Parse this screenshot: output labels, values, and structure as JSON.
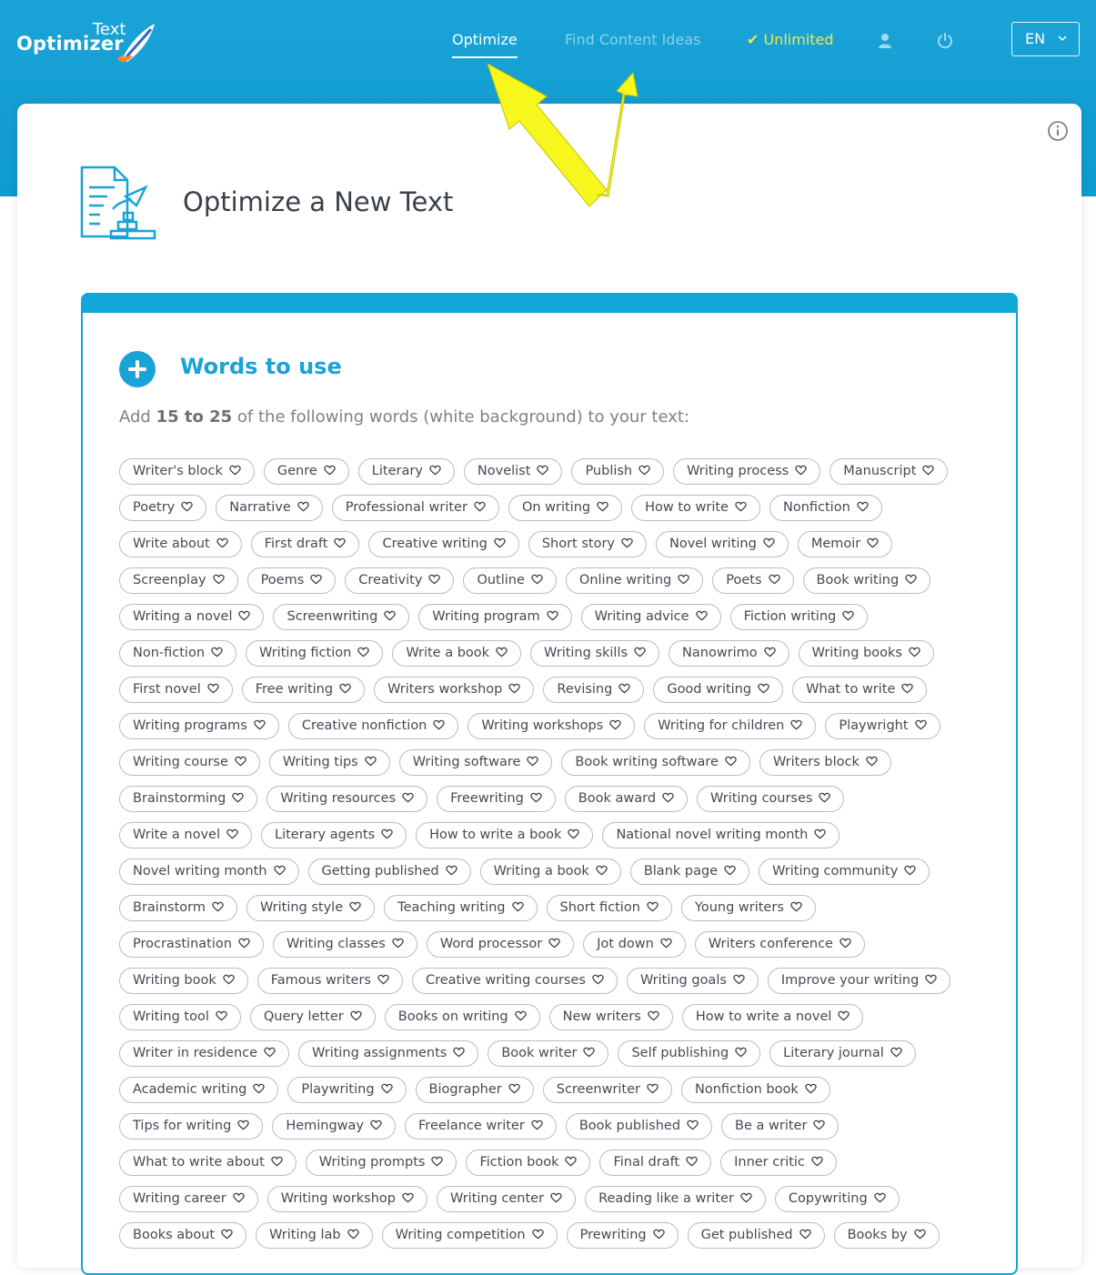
{
  "header": {
    "logo_small": "Text",
    "logo_main": "Optimizer",
    "nav": {
      "optimize": "Optimize",
      "find_content_ideas": "Find Content Ideas",
      "unlimited": "✔ Unlimited"
    },
    "lang": "EN"
  },
  "page": {
    "title": "Optimize a New Text"
  },
  "words_panel": {
    "title": "Words to use",
    "instruction_prefix": "Add ",
    "instruction_range": "15 to 25",
    "instruction_suffix": " of the following words (white background) to your text:",
    "rows": [
      [
        "Writer's block",
        "Genre",
        "Literary",
        "Novelist",
        "Publish",
        "Writing process",
        "Manuscript"
      ],
      [
        "Poetry",
        "Narrative",
        "Professional writer",
        "On writing",
        "How to write",
        "Nonfiction"
      ],
      [
        "Write about",
        "First draft",
        "Creative writing",
        "Short story",
        "Novel writing",
        "Memoir"
      ],
      [
        "Screenplay",
        "Poems",
        "Creativity",
        "Outline",
        "Online writing",
        "Poets",
        "Book writing"
      ],
      [
        "Writing a novel",
        "Screenwriting",
        "Writing program",
        "Writing advice",
        "Fiction writing"
      ],
      [
        "Non-fiction",
        "Writing fiction",
        "Write a book",
        "Writing skills",
        "Nanowrimo",
        "Writing books"
      ],
      [
        "First novel",
        "Free writing",
        "Writers workshop",
        "Revising",
        "Good writing",
        "What to write"
      ],
      [
        "Writing programs",
        "Creative nonfiction",
        "Writing workshops",
        "Writing for children",
        "Playwright"
      ],
      [
        "Writing course",
        "Writing tips",
        "Writing software",
        "Book writing software",
        "Writers block"
      ],
      [
        "Brainstorming",
        "Writing resources",
        "Freewriting",
        "Book award",
        "Writing courses"
      ],
      [
        "Write a novel",
        "Literary agents",
        "How to write a book",
        "National novel writing month"
      ],
      [
        "Novel writing month",
        "Getting published",
        "Writing a book",
        "Blank page",
        "Writing community"
      ],
      [
        "Brainstorm",
        "Writing style",
        "Teaching writing",
        "Short fiction",
        "Young writers"
      ],
      [
        "Procrastination",
        "Writing classes",
        "Word processor",
        "Jot down",
        "Writers conference"
      ],
      [
        "Writing book",
        "Famous writers",
        "Creative writing courses",
        "Writing goals",
        "Improve your writing"
      ],
      [
        "Writing tool",
        "Query letter",
        "Books on writing",
        "New writers",
        "How to write a novel"
      ],
      [
        "Writer in residence",
        "Writing assignments",
        "Book writer",
        "Self publishing",
        "Literary journal"
      ],
      [
        "Academic writing",
        "Playwriting",
        "Biographer",
        "Screenwriter",
        "Nonfiction book"
      ],
      [
        "Tips for writing",
        "Hemingway",
        "Freelance writer",
        "Book published",
        "Be a writer"
      ],
      [
        "What to write about",
        "Writing prompts",
        "Fiction book",
        "Final draft",
        "Inner critic"
      ],
      [
        "Writing career",
        "Writing workshop",
        "Writing center",
        "Reading like a writer",
        "Copywriting"
      ],
      [
        "Books about",
        "Writing lab",
        "Writing competition",
        "Prewriting",
        "Get published",
        "Books by"
      ]
    ]
  },
  "colors": {
    "brand": "#1aa3d6",
    "unlimited": "#f1e84a",
    "annotation_arrow": "#f7f71e"
  }
}
